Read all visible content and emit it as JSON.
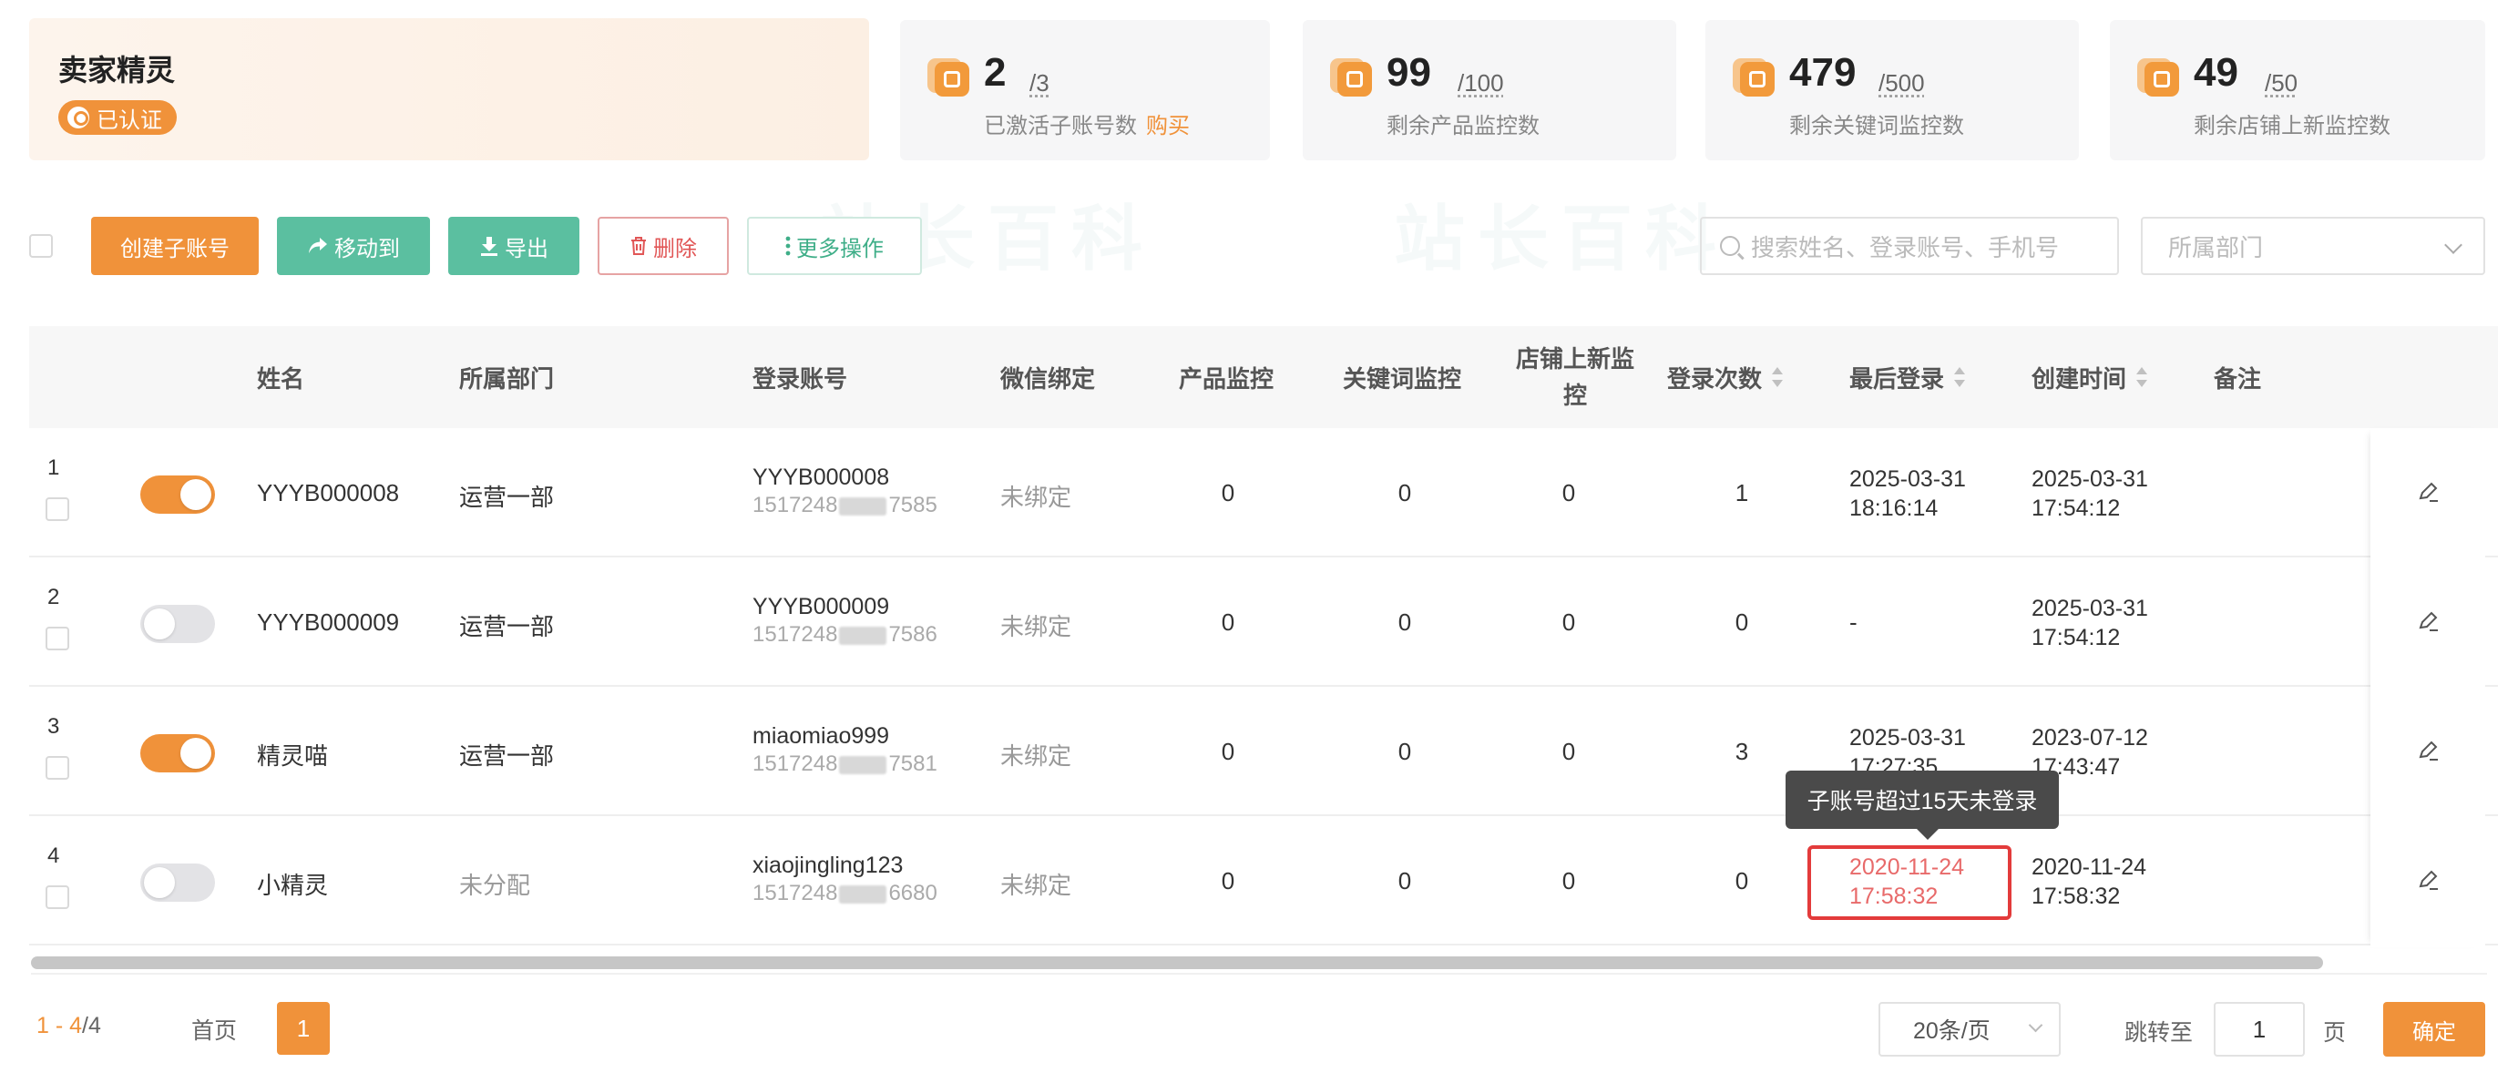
{
  "seller": {
    "name": "卖家精灵",
    "badge": "已认证"
  },
  "stats": [
    {
      "value": "2",
      "limit": "/3",
      "label": "已激活子账号数",
      "link": "购买"
    },
    {
      "value": "99",
      "limit": "/100",
      "label": "剩余产品监控数"
    },
    {
      "value": "479",
      "limit": "/500",
      "label": "剩余关键词监控数"
    },
    {
      "value": "49",
      "limit": "/50",
      "label": "剩余店铺上新监控数"
    }
  ],
  "toolbar": {
    "create": "创建子账号",
    "move": "移动到",
    "export": "导出",
    "delete": "删除",
    "more": "更多操作",
    "search_placeholder": "搜索姓名、登录账号、手机号",
    "dept_placeholder": "所属部门"
  },
  "watermark": "站长百科",
  "columns": {
    "name": "姓名",
    "dept": "所属部门",
    "account": "登录账号",
    "wechat": "微信绑定",
    "product": "产品监控",
    "keyword": "关键词监控",
    "store": "店铺上新监控",
    "logins": "登录次数",
    "last_login": "最后登录",
    "created": "创建时间",
    "remark": "备注"
  },
  "rows": [
    {
      "index": "1",
      "enabled": true,
      "name": "YYYB000008",
      "dept": "运营一部",
      "account": "YYYB000008",
      "phone_prefix": "1517248",
      "phone_suffix": "7585",
      "wechat": "未绑定",
      "product": "0",
      "keyword": "0",
      "store": "0",
      "logins": "1",
      "last_login_date": "2025-03-31",
      "last_login_time": "18:16:14",
      "created_date": "2025-03-31",
      "created_time": "17:54:12"
    },
    {
      "index": "2",
      "enabled": false,
      "name": "YYYB000009",
      "dept": "运营一部",
      "account": "YYYB000009",
      "phone_prefix": "1517248",
      "phone_suffix": "7586",
      "wechat": "未绑定",
      "product": "0",
      "keyword": "0",
      "store": "0",
      "logins": "0",
      "last_login_date": "-",
      "last_login_time": "",
      "created_date": "2025-03-31",
      "created_time": "17:54:12"
    },
    {
      "index": "3",
      "enabled": true,
      "name": "精灵喵",
      "dept": "运营一部",
      "account": "miaomiao999",
      "phone_prefix": "1517248",
      "phone_suffix": "7581",
      "wechat": "未绑定",
      "product": "0",
      "keyword": "0",
      "store": "0",
      "logins": "3",
      "last_login_date": "2025-03-31",
      "last_login_time": "17:27:35",
      "created_date": "2023-07-12",
      "created_time": "17:43:47"
    },
    {
      "index": "4",
      "enabled": false,
      "name": "小精灵",
      "dept": "未分配",
      "account": "xiaojingling123",
      "phone_prefix": "1517248",
      "phone_suffix": "6680",
      "wechat": "未绑定",
      "product": "0",
      "keyword": "0",
      "store": "0",
      "logins": "0",
      "last_login_date": "2020-11-24",
      "last_login_time": "17:58:32",
      "created_date": "2020-11-24",
      "created_time": "17:58:32"
    }
  ],
  "tooltip": "子账号超过15天未登录",
  "pagination": {
    "range": "1 - 4",
    "total": "/4",
    "first": "首页",
    "current": "1",
    "page_size": "20条/页",
    "jump_label": "跳转至",
    "jump_value": "1",
    "page_unit": "页",
    "confirm": "确定"
  },
  "colors": {
    "accent": "#f0923a",
    "green": "#5bbfa0",
    "danger": "#e15656"
  }
}
